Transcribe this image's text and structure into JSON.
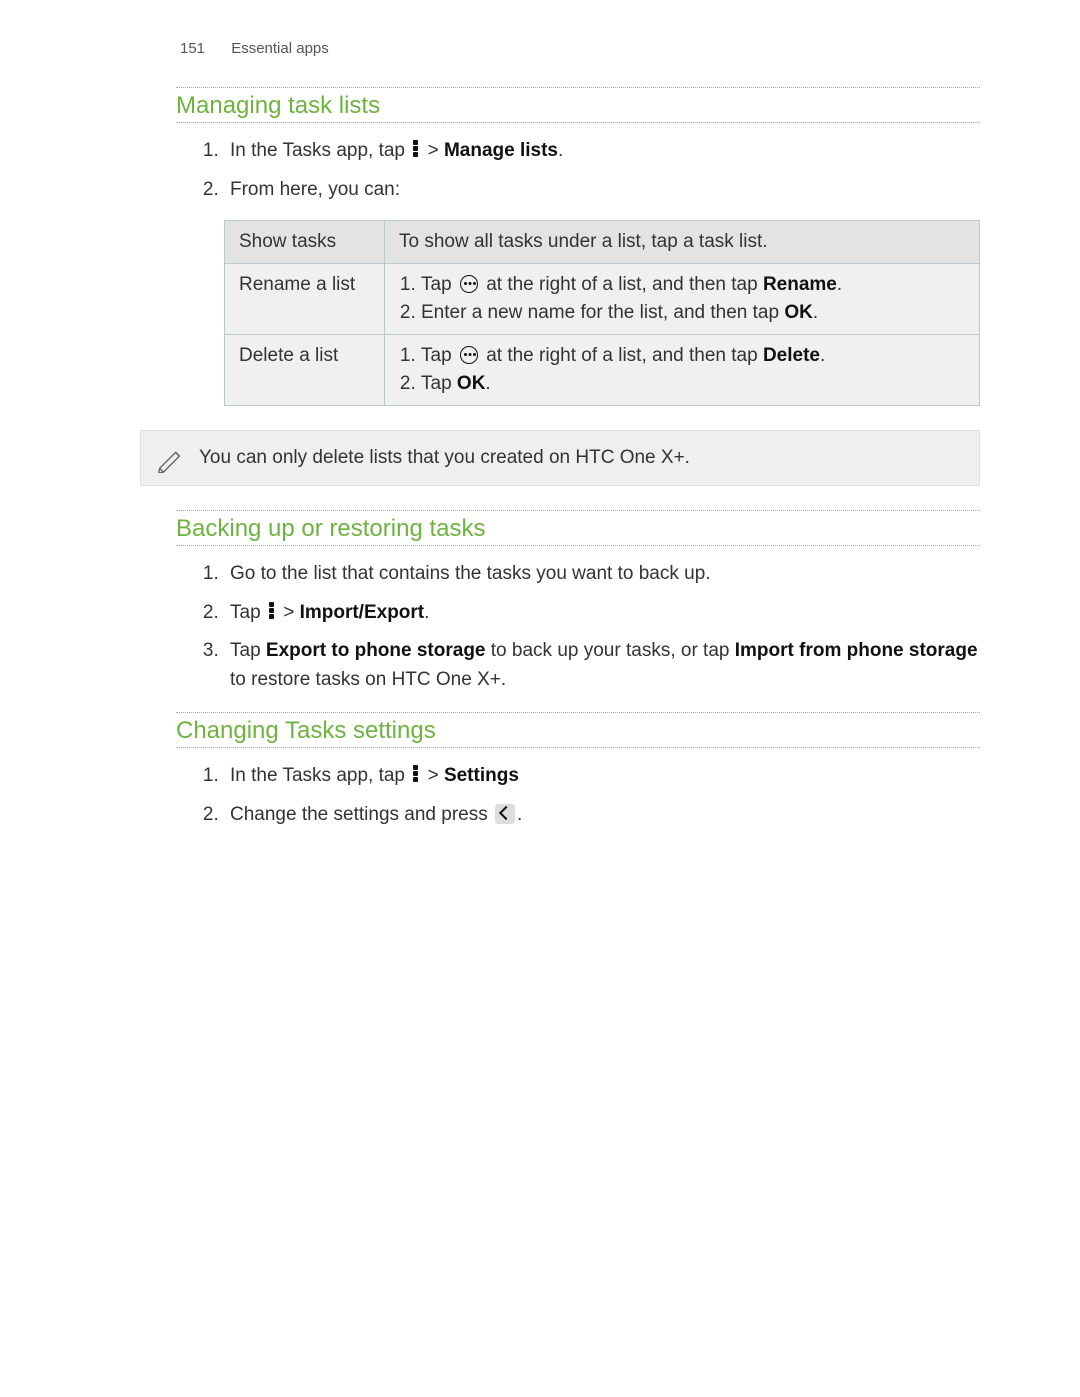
{
  "header": {
    "page_number": "151",
    "chapter": "Essential apps"
  },
  "section1": {
    "heading": "Managing task lists",
    "step1_pre": "In the Tasks app, tap ",
    "step1_post": " > ",
    "step1_bold": "Manage lists",
    "step1_end": ".",
    "step2": "From here, you can:"
  },
  "table": {
    "r1_label": "Show tasks",
    "r1_text": "To show all tasks under a list, tap a task list.",
    "r2_label": "Rename a list",
    "r2_s1_pre": "Tap ",
    "r2_s1_mid": " at the right of a list, and then tap ",
    "r2_s1_bold": "Rename",
    "r2_s1_end": ".",
    "r2_s2_pre": "Enter a new name for the list, and then tap ",
    "r2_s2_bold": "OK",
    "r2_s2_end": ".",
    "r3_label": "Delete a list",
    "r3_s1_pre": "Tap ",
    "r3_s1_mid": " at the right of a list, and then tap ",
    "r3_s1_bold": "Delete",
    "r3_s1_end": ".",
    "r3_s2_pre": "Tap ",
    "r3_s2_bold": "OK",
    "r3_s2_end": "."
  },
  "note": {
    "text": "You can only delete lists that you created on HTC One X+."
  },
  "section2": {
    "heading": "Backing up or restoring tasks",
    "step1": "Go to the list that contains the tasks you want to back up.",
    "step2_pre": "Tap ",
    "step2_post": " > ",
    "step2_bold": "Import/Export",
    "step2_end": ".",
    "step3_pre": "Tap ",
    "step3_bold1": "Export to phone storage",
    "step3_mid": " to back up your tasks, or tap ",
    "step3_bold2": "Import from phone storage",
    "step3_end": " to restore tasks on HTC One X+."
  },
  "section3": {
    "heading": "Changing Tasks settings",
    "step1_pre": "In the Tasks app, tap ",
    "step1_post": " > ",
    "step1_bold": "Settings",
    "step2_pre": "Change the settings and press ",
    "step2_end": "."
  }
}
